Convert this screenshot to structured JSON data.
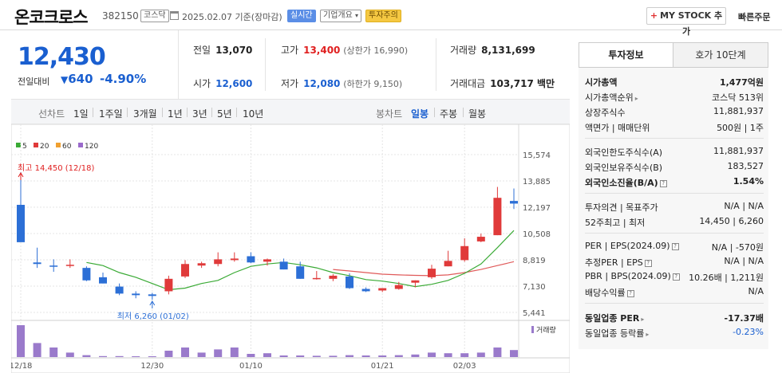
{
  "header": {
    "title": "온코크로스",
    "code": "382150",
    "market": "코스닥",
    "date": "2025.02.07 기준(장마감)",
    "live_tag": "실시간",
    "info_tag": "기업개요",
    "warn_tag": "투자주의",
    "mystock_label": "MY STOCK 추가",
    "fast_order": "빠른주문"
  },
  "price": {
    "current": "12,430",
    "change_label": "전일대비",
    "change_amount": "640",
    "change_pct": "-4.90%",
    "color_down": "#1a5fd0",
    "color_up": "#e02020"
  },
  "stats": {
    "prev_label": "전일",
    "prev": "13,070",
    "high_label": "고가",
    "high": "13,400",
    "upper_limit": "(상한가 16,990)",
    "volume_label": "거래량",
    "volume": "8,131,699",
    "open_label": "시가",
    "open": "12,600",
    "low_label": "저가",
    "low": "12,080",
    "lower_limit": "(하한가 9,150)",
    "amount_label": "거래대금",
    "amount": "103,717 백만"
  },
  "chart_tabs": {
    "line_head": "선차트",
    "line_items": [
      "1일",
      "1주일",
      "3개월",
      "1년",
      "3년",
      "5년",
      "10년"
    ],
    "candle_head": "봉차트",
    "candle_items": [
      "일봉",
      "주봉",
      "월봉"
    ],
    "candle_selected": "일봉"
  },
  "chart_data": {
    "type": "candlestick",
    "legend": [
      {
        "name": "5",
        "color": "#3aaa35"
      },
      {
        "name": "20",
        "color": "#e03a3a"
      },
      {
        "name": "60",
        "color": "#f0a030"
      },
      {
        "name": "120",
        "color": "#9a6acb"
      }
    ],
    "y_ticks": [
      "15,574",
      "13,885",
      "12,197",
      "10,508",
      "8,819",
      "7,130",
      "5,441"
    ],
    "ylim": [
      5441,
      15574
    ],
    "x_labels": [
      {
        "i": 0,
        "label": "12/18"
      },
      {
        "i": 8,
        "label": "12/30"
      },
      {
        "i": 14,
        "label": "01/10"
      },
      {
        "i": 22,
        "label": "01/21"
      },
      {
        "i": 27,
        "label": "02/03"
      }
    ],
    "high_annotation": "최고 14,450 (12/18)",
    "low_annotation": "최저 6,260 (01/02)",
    "volume_label": "거래량",
    "candles": [
      {
        "o": 12350,
        "h": 14450,
        "l": 10450,
        "c": 9950
      },
      {
        "o": 8650,
        "h": 9600,
        "l": 8300,
        "c": 8550
      },
      {
        "o": 8450,
        "h": 8850,
        "l": 8050,
        "c": 8400
      },
      {
        "o": 8450,
        "h": 8850,
        "l": 8300,
        "c": 8500
      },
      {
        "o": 8300,
        "h": 8400,
        "l": 7450,
        "c": 7500
      },
      {
        "o": 7700,
        "h": 8000,
        "l": 7300,
        "c": 7300
      },
      {
        "o": 7100,
        "h": 7300,
        "l": 6550,
        "c": 6650
      },
      {
        "o": 6650,
        "h": 6800,
        "l": 6350,
        "c": 6550
      },
      {
        "o": 6600,
        "h": 6700,
        "l": 6260,
        "c": 6500
      },
      {
        "o": 6800,
        "h": 7800,
        "l": 6600,
        "c": 7600
      },
      {
        "o": 7750,
        "h": 8800,
        "l": 7650,
        "c": 8550
      },
      {
        "o": 8450,
        "h": 8700,
        "l": 8300,
        "c": 8600
      },
      {
        "o": 8550,
        "h": 9300,
        "l": 8400,
        "c": 8850
      },
      {
        "o": 8800,
        "h": 9300,
        "l": 8700,
        "c": 8900
      },
      {
        "o": 9050,
        "h": 9300,
        "l": 8600,
        "c": 8650
      },
      {
        "o": 8700,
        "h": 8900,
        "l": 8450,
        "c": 8850
      },
      {
        "o": 8700,
        "h": 8900,
        "l": 8200,
        "c": 8200
      },
      {
        "o": 8400,
        "h": 8700,
        "l": 7600,
        "c": 7600
      },
      {
        "o": 7650,
        "h": 8100,
        "l": 7550,
        "c": 7650
      },
      {
        "o": 7600,
        "h": 7900,
        "l": 7450,
        "c": 7800
      },
      {
        "o": 7750,
        "h": 7950,
        "l": 6950,
        "c": 7000
      },
      {
        "o": 6950,
        "h": 7050,
        "l": 6750,
        "c": 6800
      },
      {
        "o": 6850,
        "h": 7000,
        "l": 6750,
        "c": 7000
      },
      {
        "o": 6950,
        "h": 7400,
        "l": 6900,
        "c": 7200
      },
      {
        "o": 7350,
        "h": 7500,
        "l": 7050,
        "c": 7500
      },
      {
        "o": 7700,
        "h": 8500,
        "l": 7600,
        "c": 8250
      },
      {
        "o": 8400,
        "h": 9400,
        "l": 8400,
        "c": 8750
      },
      {
        "o": 8800,
        "h": 10200,
        "l": 8700,
        "c": 9700
      },
      {
        "o": 10000,
        "h": 10500,
        "l": 9950,
        "c": 10300
      },
      {
        "o": 10400,
        "h": 13500,
        "l": 10400,
        "c": 12800
      },
      {
        "o": 12600,
        "h": 13400,
        "l": 12080,
        "c": 12430
      }
    ],
    "ma5": [
      null,
      null,
      null,
      null,
      8650,
      8450,
      8000,
      7700,
      7300,
      6900,
      7000,
      7300,
      7500,
      8000,
      8400,
      8550,
      8650,
      8500,
      8300,
      8000,
      7800,
      7550,
      7450,
      7300,
      7100,
      7250,
      7500,
      7950,
      8550,
      9600,
      10700
    ],
    "ma20": [
      null,
      null,
      null,
      null,
      null,
      null,
      null,
      null,
      null,
      null,
      null,
      null,
      null,
      null,
      null,
      null,
      null,
      null,
      null,
      8200,
      8100,
      8000,
      7900,
      7850,
      7820,
      7800,
      7850,
      8000,
      8200,
      8450,
      8700
    ],
    "volume": [
      1.0,
      0.44,
      0.3,
      0.14,
      0.06,
      0.03,
      0.03,
      0.02,
      0.02,
      0.2,
      0.3,
      0.14,
      0.24,
      0.3,
      0.1,
      0.12,
      0.05,
      0.05,
      0.04,
      0.04,
      0.06,
      0.05,
      0.05,
      0.06,
      0.08,
      0.14,
      0.12,
      0.12,
      0.14,
      0.3,
      0.22
    ],
    "colors": {
      "up": "#e03a3a",
      "down": "#2c6fd6",
      "ma5": "#3aaa35",
      "ma20": "#e05a5a",
      "volume": "#9a7acb",
      "grid": "#e4e4e4"
    }
  },
  "rpanel": {
    "tab_info": "투자정보",
    "tab_hoga": "호가 10단계",
    "market_cap_label": "시가총액",
    "market_cap": "1,477억원",
    "cap_rank_label": "시가총액순위",
    "cap_rank": "코스닥 513위",
    "shares_label": "상장주식수",
    "shares": "11,881,937",
    "par_label": "액면가 | 매매단위",
    "par": "500원 | 1주",
    "foreign_limit_label": "외국인한도주식수(A)",
    "foreign_limit": "11,881,937",
    "foreign_hold_label": "외국인보유주식수(B)",
    "foreign_hold": "183,527",
    "foreign_ratio_label": "외국인소진율(B/A)",
    "foreign_ratio": "1.54%",
    "opinion_label": "투자의견 | 목표주가",
    "opinion": "N/A | N/A",
    "w52_label": "52주최고 | 최저",
    "w52": "14,450 | 6,260",
    "per_label": "PER | EPS(2024.09)",
    "per": "N/A | -570원",
    "est_label": "추정PER | EPS",
    "est": "N/A | N/A",
    "pbr_label": "PBR | BPS(2024.09)",
    "pbr": "10.26배 | 1,211원",
    "div_label": "배당수익률",
    "div": "N/A",
    "sector_per_label": "동일업종 PER",
    "sector_per": "-17.37배",
    "sector_rate_label": "동일업종 등락률",
    "sector_rate": "-0.23%"
  }
}
